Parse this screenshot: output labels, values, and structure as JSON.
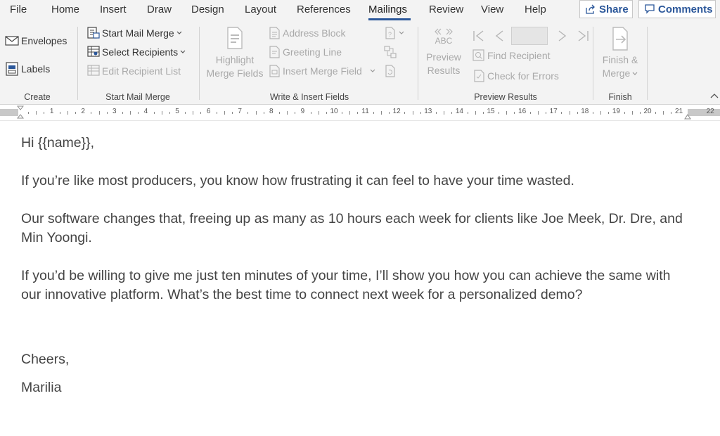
{
  "menu": {
    "tabs": [
      "File",
      "Home",
      "Insert",
      "Draw",
      "Design",
      "Layout",
      "References",
      "Mailings",
      "Review",
      "View",
      "Help"
    ],
    "active_tab": "Mailings",
    "share_label": "Share",
    "comments_label": "Comments"
  },
  "ribbon": {
    "create": {
      "envelopes": "Envelopes",
      "labels": "Labels",
      "group_label": "Create"
    },
    "start_mail_merge": {
      "start": "Start Mail Merge",
      "select_recipients": "Select Recipients",
      "edit_list": "Edit Recipient List",
      "group_label": "Start Mail Merge"
    },
    "write_insert": {
      "highlight_line1": "Highlight",
      "highlight_line2": "Merge Fields",
      "address_block": "Address Block",
      "greeting_line": "Greeting Line",
      "insert_merge_field": "Insert Merge Field",
      "group_label": "Write & Insert Fields"
    },
    "preview": {
      "abc": "ABC",
      "preview_line1": "Preview",
      "preview_line2": "Results",
      "find_recipient": "Find Recipient",
      "check_errors": "Check for Errors",
      "group_label": "Preview Results"
    },
    "finish": {
      "line1": "Finish &",
      "line2": "Merge",
      "group_label": "Finish"
    }
  },
  "ruler": {
    "numbers": [
      "1",
      "2",
      "3",
      "4",
      "5",
      "6",
      "7",
      "8",
      "9",
      "10",
      "11",
      "12",
      "13",
      "14",
      "15",
      "16",
      "17",
      "18",
      "19",
      "20",
      "21",
      "22"
    ]
  },
  "document": {
    "greeting": "Hi {{name}},",
    "p1": "If you’re like most producers, you know how frustrating it can feel to have your time wasted.",
    "p2": "Our software changes that, freeing up as many as 10 hours each week for clients like Joe Meek, Dr. Dre, and Min Yoongi.",
    "p3": "If you’d be willing to give me just ten minutes of your time, I’ll show you how you can achieve the same with our innovative platform. What’s the best time to connect next week for a personalized demo?",
    "closing": "Cheers,",
    "signature": "Marilia"
  }
}
